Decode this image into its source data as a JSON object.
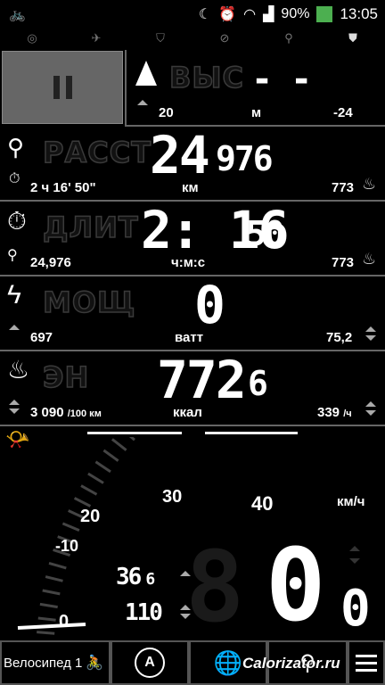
{
  "status": {
    "battery": "90%",
    "time": "13:05"
  },
  "tabs": [
    {
      "icon": "record-icon"
    },
    {
      "icon": "satellite-icon"
    },
    {
      "icon": "shield-icon"
    },
    {
      "icon": "pulse-icon"
    },
    {
      "icon": "route-pin-icon"
    },
    {
      "icon": "pocket-icon"
    }
  ],
  "altitude": {
    "label": "ВЫС",
    "value": "- -",
    "sub_left": "20",
    "unit": "м",
    "sub_right": "-24"
  },
  "distance": {
    "label": "РАССТ",
    "value_main": "24",
    "value_frac": "976",
    "sub_left": "2 ч 16' 50\"",
    "unit": "км",
    "sub_right": "773"
  },
  "duration": {
    "label": "ДЛИТ",
    "value_main": "2: 16",
    "value_frac": "50",
    "sub_left": "24,976",
    "unit": "ч:м:с",
    "sub_right": "773"
  },
  "power": {
    "label": "МОЩ",
    "value": "0",
    "sub_left": "697",
    "unit": "ватт",
    "sub_right": "75,2"
  },
  "energy": {
    "label": "ЭН",
    "value_main": "772",
    "value_frac": "6",
    "sub_left": "3 090",
    "sub_left_unit": "/100 км",
    "unit": "ккал",
    "sub_right": "339",
    "sub_right_unit": "/ч"
  },
  "speedo": {
    "ticks": [
      "0",
      "-10",
      "20",
      "30",
      "40"
    ],
    "unit": "км/ч",
    "cadence": "36",
    "cadence_frac": "6",
    "heart": "110",
    "speed_main": "0",
    "speed_frac": "0"
  },
  "bottom": {
    "profile": "Велосипед 1",
    "watermark": "Calorizator.ru"
  }
}
